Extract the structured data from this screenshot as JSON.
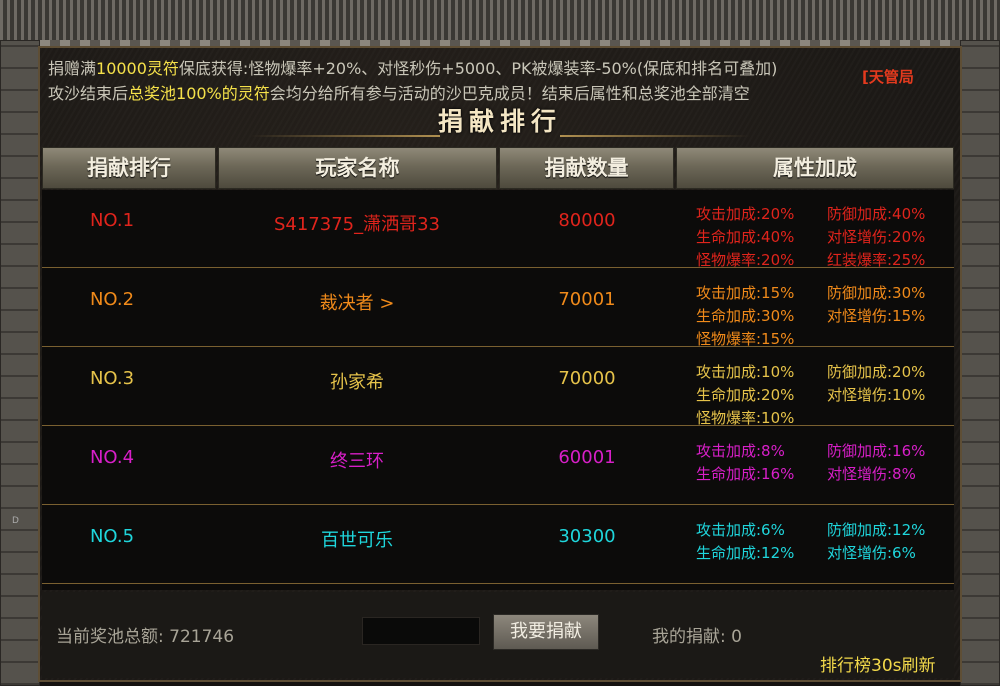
{
  "notice": {
    "line1_a": "捐赠满",
    "line1_b": "10000灵符",
    "line1_c": "保底获得:怪物爆率+20%、对怪秒伤+5000、PK被爆装率-50%(保底和排名可叠加)",
    "line2_a": "攻沙结束后",
    "line2_b": "总奖池100%的灵符",
    "line2_c": "会均分给所有参与活动的沙巴克成员！结束后属性和总奖池全部清空",
    "tag": "[天管局"
  },
  "title": "捐献排行",
  "headers": [
    "捐献排行",
    "玩家名称",
    "捐献数量",
    "属性加成"
  ],
  "rows": [
    {
      "rank": "NO.1",
      "name": "S417375_潇洒哥33",
      "amount": "80000",
      "color": "#e0241c",
      "attrs": [
        "攻击加成:20%",
        "防御加成:40%",
        "生命加成:40%",
        "对怪增伤:20%",
        "怪物爆率:20%",
        "红装爆率:25%"
      ]
    },
    {
      "rank": "NO.2",
      "name": "裁决者 >",
      "amount": "70001",
      "color": "#f08a1a",
      "attrs": [
        "攻击加成:15%",
        "防御加成:30%",
        "生命加成:30%",
        "对怪增伤:15%",
        "怪物爆率:15%"
      ]
    },
    {
      "rank": "NO.3",
      "name": "孙家希",
      "amount": "70000",
      "color": "#e6c34a",
      "attrs": [
        "攻击加成:10%",
        "防御加成:20%",
        "生命加成:20%",
        "对怪增伤:10%",
        "怪物爆率:10%"
      ]
    },
    {
      "rank": "NO.4",
      "name": "终三环",
      "amount": "60001",
      "color": "#d81fc8",
      "attrs": [
        "攻击加成:8%",
        "防御加成:16%",
        "生命加成:16%",
        "对怪增伤:8%"
      ]
    },
    {
      "rank": "NO.5",
      "name": "百世可乐",
      "amount": "30300",
      "color": "#1fd6dc",
      "attrs": [
        "攻击加成:6%",
        "防御加成:12%",
        "生命加成:12%",
        "对怪增伤:6%"
      ]
    }
  ],
  "footer": {
    "pool": "当前奖池总额: 721746",
    "donate_button": "我要捐献",
    "input_value": "",
    "mine": "我的捐献: 0",
    "refresh": "排行榜30s刷新"
  },
  "side_marker": "D"
}
